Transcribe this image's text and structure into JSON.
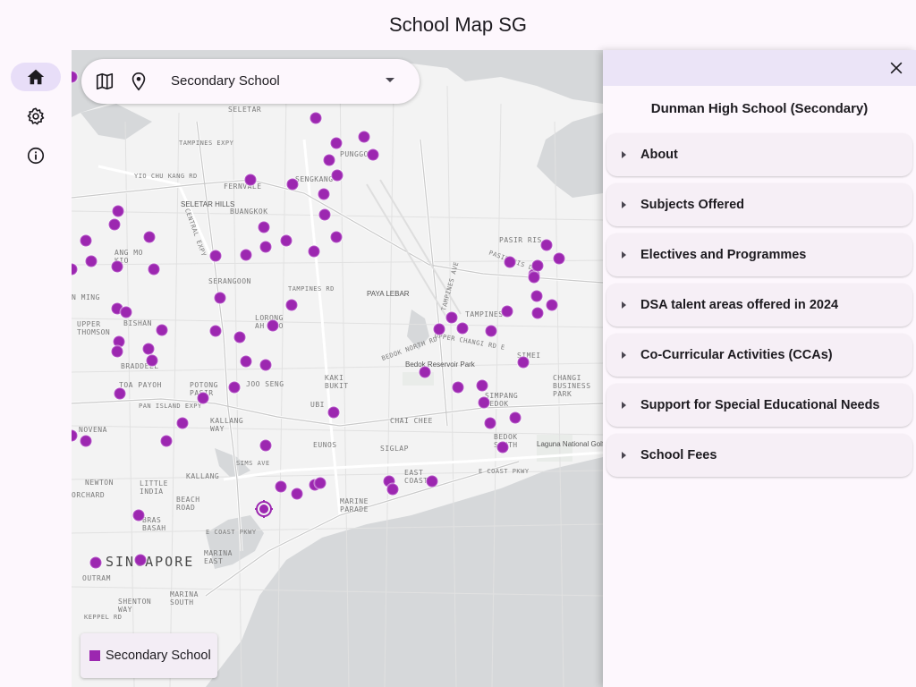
{
  "app": {
    "title": "School Map SG"
  },
  "nav": {
    "items": [
      {
        "name": "home",
        "icon": "home-icon",
        "active": true
      },
      {
        "name": "settings",
        "icon": "gear-icon",
        "active": false
      },
      {
        "name": "about",
        "icon": "info-icon",
        "active": false
      }
    ]
  },
  "search": {
    "map_icon": "map-icon",
    "pin_icon": "location-pin-icon",
    "selected_level": "Secondary School"
  },
  "legend": {
    "label": "Secondary School",
    "color": "#9c27b0"
  },
  "map": {
    "labels": {
      "seletar": "SELETAR",
      "tampines_expy": "TAMPINES EXPY",
      "yio_chu_kang": "YIO CHU KANG RD",
      "fernvale": "FERNVALE",
      "sengkang": "SENGKANG",
      "punggol": "PUNGGOL",
      "seletar_hills": "SELETAR HILLS",
      "buangkok": "BUANGKOK",
      "central_expy": "CENTRAL EXPY",
      "ang_mo_kio": "ANG MO KIO",
      "serangoon": "SERANGOON",
      "tampines_rd": "TAMPINES RD",
      "pasir_ris": "PASIR RIS",
      "paya_lebar": "PAYA LEBAR",
      "ming": "N MING",
      "upper_thomson": "UPPER THOMSON",
      "bishan": "BISHAN",
      "lorong_ah_soo": "LORONG AH SOO",
      "tampines": "TAMPINES",
      "braddell": "BRADDELL",
      "toa_payoh": "TOA PAYOH",
      "potong_pasir": "POTONG PASIR",
      "joo_seng": "JOO SENG",
      "kaki_bukit": "KAKI BUKIT",
      "bedok_reservoir": "Bedok Reservoir Park",
      "simei": "SIMEI",
      "changi_business_park": "CHANGI BUSINESS PARK",
      "simpang_bedok": "SIMPANG BEDOK",
      "pan_island_expy": "PAN ISLAND EXPY",
      "ubi": "UBI",
      "chai_chee": "CHAI CHEE",
      "novena": "NOVENA",
      "kallang_way": "KALLANG WAY",
      "bedok_south": "BEDOK SOUTH",
      "laguna": "Laguna National Golf & Country Club",
      "eunos": "EUNOS",
      "siglap": "SIGLAP",
      "east_coast": "EAST COAST",
      "e_coast_pkwy": "E COAST PKWY",
      "kallang": "KALLANG",
      "sims_ave": "SIMS AVE",
      "newton": "NEWTON",
      "orchard": "ORCHARD",
      "little_india": "LITTLE INDIA",
      "beach_road": "BEACH ROAD",
      "marine_parade": "MARINE PARADE",
      "bras_basah": "BRAS BASAH",
      "e_coast_pkwy2": "E COAST PKWY",
      "singapore": "SINGAPORE",
      "outram": "OUTRAM",
      "marina_east": "MARINA EAST",
      "shenton_way": "SHENTON WAY",
      "marina_south": "MARINA SOUTH",
      "keppel_rd": "KEPPEL RD",
      "pasir_ris_dr": "PASIR RIS DR",
      "tampines_ave": "TAMPINES AVE",
      "bedok_north": "BEDOK NORTH RD",
      "upper_changi": "UPPER CHANGI RD E"
    },
    "selected_school_marker": "target-marker-icon"
  },
  "panel": {
    "title": "Dunman High School (Secondary)",
    "sections": [
      "About",
      "Subjects Offered",
      "Electives and Programmes",
      "DSA talent areas offered in 2024",
      "Co-Curricular Activities (CCAs)",
      "Support for Special Educational Needs",
      "School Fees"
    ]
  }
}
